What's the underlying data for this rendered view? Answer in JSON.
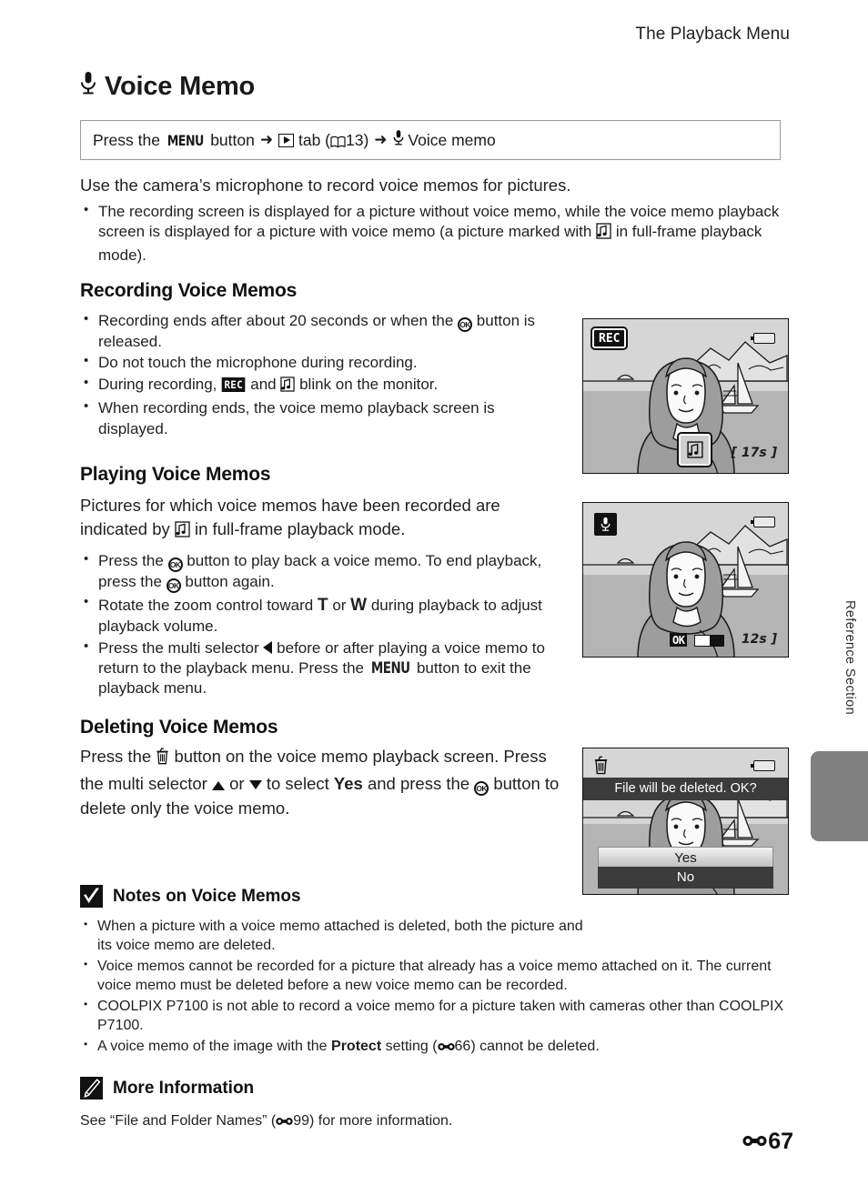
{
  "running_head": "The Playback Menu",
  "chapter": {
    "title": "Voice Memo",
    "icon": "microphone-icon"
  },
  "path_box": {
    "prefix": "Press the",
    "menu_label": "MENU",
    "button_word": "button",
    "tab_word": "tab",
    "tab_ref_open": "(",
    "tab_ref_page": "13",
    "tab_ref_close": ")",
    "destination": "Voice memo",
    "arrow": "➜"
  },
  "intro": "Use the camera’s microphone to record voice memos for pictures.",
  "intro_bullets": [
    {
      "part1": "The recording screen is displayed for a picture without voice memo, while the voice memo playback screen is displayed for a picture with voice memo (a picture marked with",
      "part2": "in full-frame playback mode)."
    }
  ],
  "sections": [
    {
      "id": "recording",
      "heading": "Recording Voice Memos",
      "bullets": [
        {
          "a": "Recording ends after about 20 seconds or when the",
          "icon": "ok-icon",
          "b": "button is released."
        },
        {
          "a": "Do not touch the microphone during recording."
        },
        {
          "a": "During recording,",
          "icon": "rec-tag",
          "b": "and",
          "icon2": "voice-memo-icon",
          "c": "blink on the monitor."
        },
        {
          "a": "When recording ends, the voice memo playback screen is displayed."
        }
      ]
    },
    {
      "id": "playing",
      "heading": "Playing Voice Memos",
      "lead_a": "Pictures for which voice memos have been recorded are indicated by",
      "lead_b": "in full-frame playback mode.",
      "bullets": [
        {
          "a": "Press the",
          "b": "button to play back a voice memo. To end playback, press the",
          "c": "button again."
        },
        {
          "a": "Rotate the zoom control toward",
          "t": "T",
          "b": "or",
          "w": "W",
          "c": "during playback to adjust playback volume."
        },
        {
          "a": "Press the multi selector",
          "b": "before or after playing a voice memo to return to the playback menu. Press the",
          "menu": "MENU",
          "c": "button to exit the playback menu."
        }
      ]
    },
    {
      "id": "deleting",
      "heading": "Deleting Voice Memos",
      "body_a": "Press the",
      "body_b": "button on the voice memo playback screen. Press the multi selector",
      "body_or": "or",
      "body_c": "to select",
      "body_yes": "Yes",
      "body_d": "and press the",
      "body_e": "button to delete only the voice memo."
    }
  ],
  "notes": {
    "icon": "check-mark-icon",
    "heading": "Notes on Voice Memos",
    "bullets": [
      "When a picture with a voice memo attached is deleted, both the picture and its voice memo are deleted.",
      "Voice memos cannot be recorded for a picture that already has a voice memo attached on it. The current voice memo must be deleted before a new voice memo can be recorded.",
      "COOLPIX P7100 is not able to record a voice memo for a picture taken with cameras other than COOLPIX P7100.",
      {
        "a": "A voice memo of the image with the",
        "bold": "Protect",
        "b": "setting (",
        "ref": "66",
        "c": ") cannot be deleted."
      }
    ]
  },
  "more_info": {
    "icon": "pencil-icon",
    "heading": "More Information",
    "body_a": "See “File and Folder Names” (",
    "ref": "99",
    "body_b": ") for more information."
  },
  "screens": [
    {
      "id": "recording-screen",
      "badge": "REC",
      "battery": "battery-icon",
      "vm_badge": "voice-memo-icon",
      "timer": "[  17s ]"
    },
    {
      "id": "playback-screen",
      "mic": "microphone-icon",
      "battery": "battery-icon",
      "ok": "OK",
      "timer": "12s ]"
    },
    {
      "id": "delete-confirm-screen",
      "trash": "trash-icon",
      "battery": "battery-icon",
      "message": "File will be deleted. OK?",
      "options": [
        {
          "label": "Yes",
          "selected": true
        },
        {
          "label": "No",
          "selected": false
        }
      ]
    }
  ],
  "side_label": "Reference Section",
  "folio": {
    "symbol": "reference-section-symbol",
    "page": "67"
  }
}
